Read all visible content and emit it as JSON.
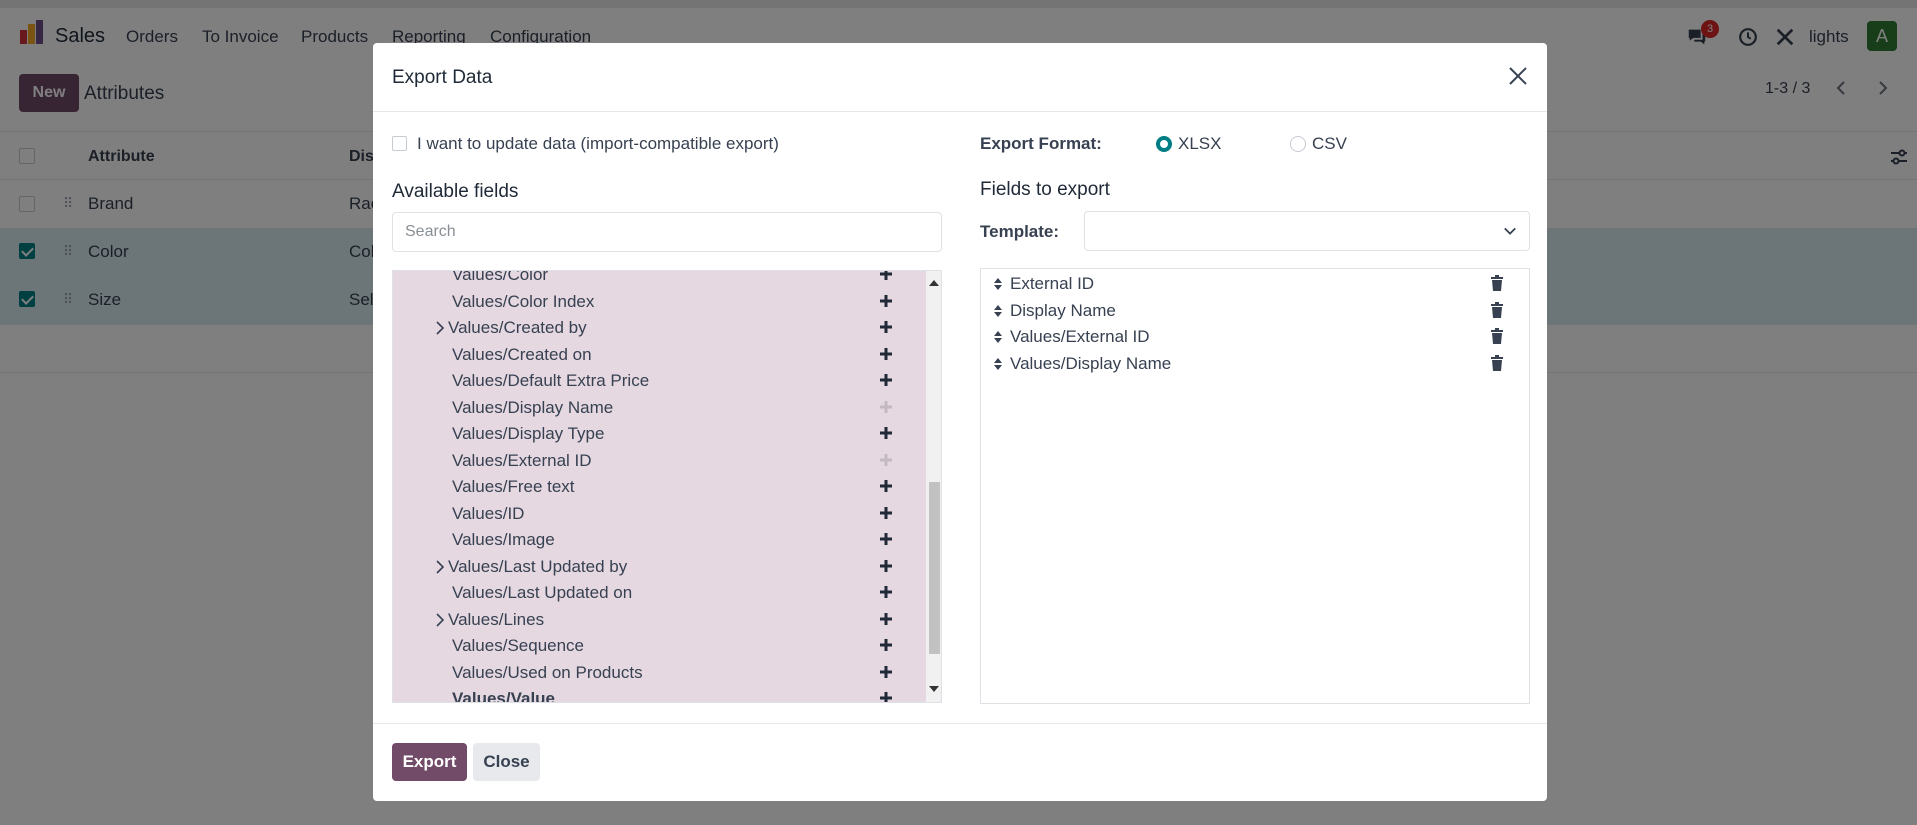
{
  "app": {
    "name": "Sales",
    "user": "lights",
    "avatar_letter": "A",
    "message_count": "3"
  },
  "menu": [
    "Orders",
    "To Invoice",
    "Products",
    "Reporting",
    "Configuration"
  ],
  "control_panel": {
    "new_label": "New",
    "breadcrumb": "Attributes",
    "pager": "1-3 / 3"
  },
  "list": {
    "columns": [
      "Attribute",
      "Dis"
    ],
    "rows": [
      {
        "attribute": "Brand",
        "display": "Rac",
        "selected": false
      },
      {
        "attribute": "Color",
        "display": "Col",
        "selected": true
      },
      {
        "attribute": "Size",
        "display": "Sel",
        "selected": true
      }
    ]
  },
  "modal": {
    "title": "Export Data",
    "import_compat_label": "I want to update data (import-compatible export)",
    "available_title": "Available fields",
    "search_placeholder": "Search",
    "export_format_label": "Export Format:",
    "formats": [
      {
        "label": "XLSX",
        "checked": true
      },
      {
        "label": "CSV",
        "checked": false
      }
    ],
    "fields_to_export_title": "Fields to export",
    "template_label": "Template:",
    "template_value": "",
    "available_fields": [
      {
        "label": "Values/Color",
        "expandable": false,
        "added": false,
        "bold": false
      },
      {
        "label": "Values/Color Index",
        "expandable": false,
        "added": false,
        "bold": false
      },
      {
        "label": "Values/Created by",
        "expandable": true,
        "added": false,
        "bold": false
      },
      {
        "label": "Values/Created on",
        "expandable": false,
        "added": false,
        "bold": false
      },
      {
        "label": "Values/Default Extra Price",
        "expandable": false,
        "added": false,
        "bold": false
      },
      {
        "label": "Values/Display Name",
        "expandable": false,
        "added": true,
        "bold": false
      },
      {
        "label": "Values/Display Type",
        "expandable": false,
        "added": false,
        "bold": false
      },
      {
        "label": "Values/External ID",
        "expandable": false,
        "added": true,
        "bold": false
      },
      {
        "label": "Values/Free text",
        "expandable": false,
        "added": false,
        "bold": false
      },
      {
        "label": "Values/ID",
        "expandable": false,
        "added": false,
        "bold": false
      },
      {
        "label": "Values/Image",
        "expandable": false,
        "added": false,
        "bold": false
      },
      {
        "label": "Values/Last Updated by",
        "expandable": true,
        "added": false,
        "bold": false
      },
      {
        "label": "Values/Last Updated on",
        "expandable": false,
        "added": false,
        "bold": false
      },
      {
        "label": "Values/Lines",
        "expandable": true,
        "added": false,
        "bold": false
      },
      {
        "label": "Values/Sequence",
        "expandable": false,
        "added": false,
        "bold": false
      },
      {
        "label": "Values/Used on Products",
        "expandable": false,
        "added": false,
        "bold": false
      },
      {
        "label": "Values/Value",
        "expandable": false,
        "added": false,
        "bold": true
      }
    ],
    "export_fields": [
      "External ID",
      "Display Name",
      "Values/External ID",
      "Values/Display Name"
    ],
    "export_button": "Export",
    "close_button": "Close"
  },
  "colors": {
    "brand": "#714b67",
    "accent": "#017e84",
    "tree_bg": "#e5d8e1"
  }
}
